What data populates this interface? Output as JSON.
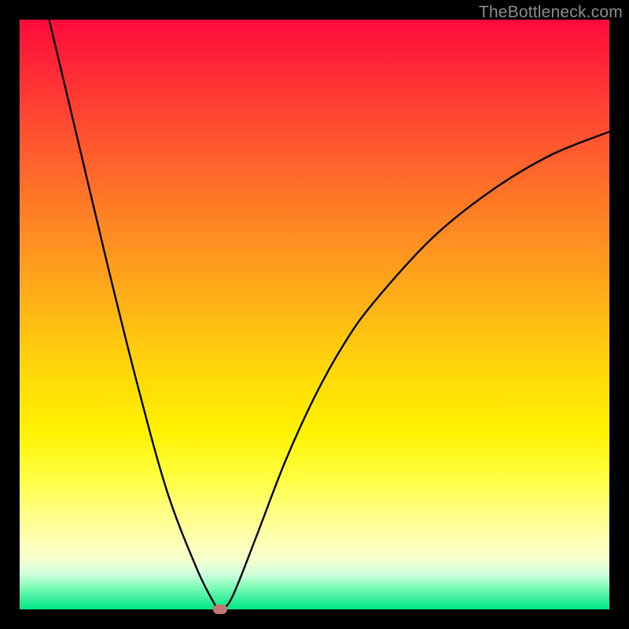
{
  "watermark": "TheBottleneck.com",
  "chart_data": {
    "type": "line",
    "title": "",
    "xlabel": "",
    "ylabel": "",
    "xlim": [
      0,
      100
    ],
    "ylim": [
      0,
      100
    ],
    "grid": false,
    "legend": false,
    "series": [
      {
        "name": "curve",
        "x": [
          5,
          10,
          15,
          20,
          25,
          30,
          33,
          34,
          36,
          40,
          45,
          50,
          55,
          60,
          70,
          80,
          90,
          100
        ],
        "y": [
          100,
          79,
          58,
          38,
          20,
          7,
          1,
          0,
          2,
          12,
          25,
          36,
          45,
          52,
          63,
          71,
          77,
          81
        ]
      }
    ],
    "marker": {
      "x": 34,
      "y": 0,
      "color": "#c27772"
    },
    "background_gradient": {
      "top": "#ff0a3a",
      "mid": "#fff200",
      "bottom": "#00e888"
    }
  }
}
